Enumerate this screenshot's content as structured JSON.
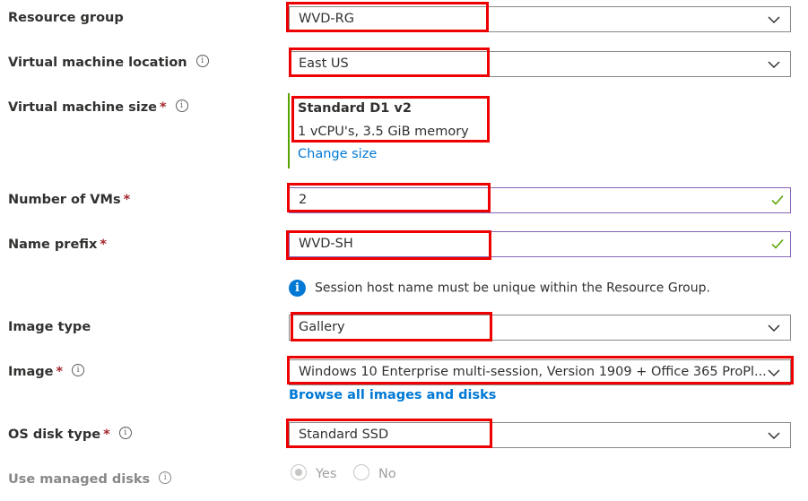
{
  "form": {
    "resource_group": {
      "label": "Resource group",
      "value": "WVD-RG"
    },
    "vm_location": {
      "label": "Virtual machine location",
      "info": "i",
      "value": "East US"
    },
    "vm_size": {
      "label": "Virtual machine size",
      "required": "*",
      "info": "i",
      "name": "Standard D1 v2",
      "description": "1 vCPU's, 3.5 GiB memory",
      "change_link": "Change size"
    },
    "num_vms": {
      "label": "Number of VMs",
      "required": "*",
      "value": "2"
    },
    "name_prefix": {
      "label": "Name prefix",
      "required": "*",
      "value": "WVD-SH"
    },
    "notice": {
      "icon": "i",
      "text": "Session host name must be unique within the Resource Group."
    },
    "image_type": {
      "label": "Image type",
      "value": "Gallery"
    },
    "image": {
      "label": "Image",
      "required": "*",
      "info": "i",
      "value": "Windows 10 Enterprise multi-session, Version 1909 + Office 365 ProPl...",
      "browse_link": "Browse all images and disks"
    },
    "os_disk": {
      "label": "OS disk type",
      "required": "*",
      "info": "i",
      "value": "Standard SSD"
    },
    "managed_disks": {
      "label": "Use managed disks",
      "info": "i",
      "options": [
        "Yes",
        "No"
      ],
      "selected": "Yes"
    }
  },
  "icons": {
    "dropdown": "chevron-down-icon",
    "valid": "checkmark-icon",
    "info": "info-icon",
    "notice": "info-filled-icon"
  },
  "colors": {
    "link": "#0078d4",
    "highlight": "#ee0000",
    "valid_check": "#57a300",
    "valid_border": "#8764b8",
    "size_accent": "#57a300"
  }
}
